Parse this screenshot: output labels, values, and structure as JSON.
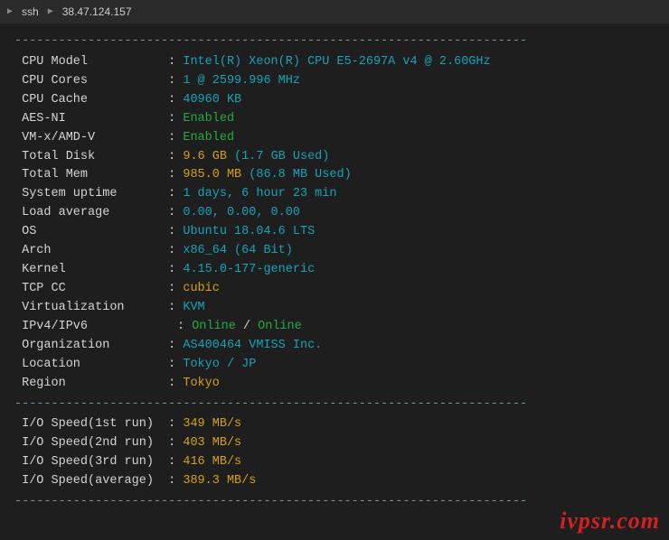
{
  "header": {
    "label_ssh": "ssh",
    "host": "38.47.124.157"
  },
  "divider": "----------------------------------------------------------------------",
  "info": [
    {
      "label": "CPU Model",
      "value": "Intel(R) Xeon(R) CPU E5-2697A v4 @ 2.60GHz",
      "cls": "val-cyan"
    },
    {
      "label": "CPU Cores",
      "value": "1 @ 2599.996 MHz",
      "cls": "val-cyan"
    },
    {
      "label": "CPU Cache",
      "value": "40960 KB",
      "cls": "val-cyan"
    },
    {
      "label": "AES-NI",
      "value": "Enabled",
      "cls": "val-green"
    },
    {
      "label": "VM-x/AMD-V",
      "value": "Enabled",
      "cls": "val-green"
    },
    {
      "label": "Total Disk",
      "value": "9.6 GB",
      "cls": "val-yellow",
      "suffix": "(1.7 GB Used)",
      "suffixCls": "val-cyan"
    },
    {
      "label": "Total Mem",
      "value": "985.0 MB",
      "cls": "val-yellow",
      "suffix": "(86.8 MB Used)",
      "suffixCls": "val-cyan"
    },
    {
      "label": "System uptime",
      "value": "1 days, 6 hour 23 min",
      "cls": "val-cyan"
    },
    {
      "label": "Load average",
      "value": "0.00, 0.00, 0.00",
      "cls": "val-cyan"
    },
    {
      "label": "OS",
      "value": "Ubuntu 18.04.6 LTS",
      "cls": "val-cyan"
    },
    {
      "label": "Arch",
      "value": "x86_64 (64 Bit)",
      "cls": "val-cyan"
    },
    {
      "label": "Kernel",
      "value": "4.15.0-177-generic",
      "cls": "val-cyan"
    },
    {
      "label": "TCP CC",
      "value": "cubic",
      "cls": "val-yellow"
    },
    {
      "label": "Virtualization",
      "value": "KVM",
      "cls": "val-cyan"
    }
  ],
  "ipv": {
    "label": "IPv4/IPv6",
    "v4": "Online",
    "sep": " / ",
    "v6": "Online"
  },
  "info2": [
    {
      "label": "Organization",
      "value": "AS400464 VMISS Inc.",
      "cls": "val-cyan"
    },
    {
      "label": "Location",
      "value": "Tokyo / JP",
      "cls": "val-cyan"
    },
    {
      "label": "Region",
      "value": "Tokyo",
      "cls": "val-yellow"
    }
  ],
  "io": [
    {
      "label": "I/O Speed(1st run)",
      "value": "349 MB/s"
    },
    {
      "label": "I/O Speed(2nd run)",
      "value": "403 MB/s"
    },
    {
      "label": "I/O Speed(3rd run)",
      "value": "416 MB/s"
    },
    {
      "label": "I/O Speed(average)",
      "value": "389.3 MB/s"
    }
  ],
  "watermark": "ivpsr.com"
}
